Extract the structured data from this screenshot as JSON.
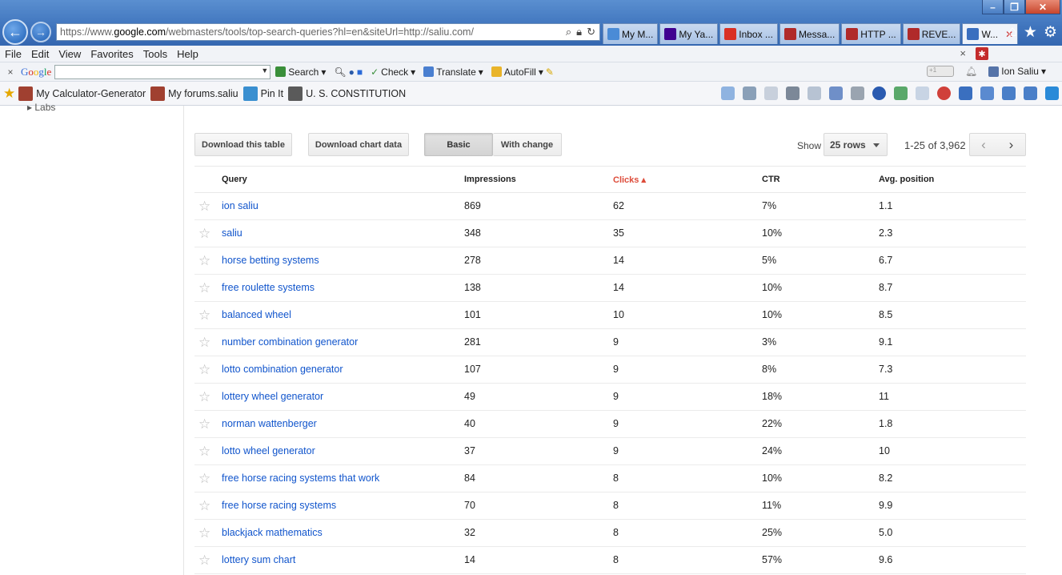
{
  "browser": {
    "url_prefix": "https://www.",
    "url_domain": "google.com",
    "url_rest": "/webmasters/tools/top-search-queries?hl=en&siteUrl=http://saliu.com/",
    "tabs": [
      {
        "label": "My M...",
        "color": "#4a8bd6"
      },
      {
        "label": "My Ya...",
        "color": "#400090"
      },
      {
        "label": "Inbox ...",
        "color": "#d93025"
      },
      {
        "label": "Messa...",
        "color": "#b02a2a"
      },
      {
        "label": "HTTP ...",
        "color": "#b02a2a"
      },
      {
        "label": "REVE...",
        "color": "#b02a2a"
      },
      {
        "label": "W...",
        "color": "#3a6fbf",
        "active": true
      }
    ],
    "menu": [
      "File",
      "Edit",
      "View",
      "Favorites",
      "Tools",
      "Help"
    ],
    "google_bar": {
      "logo": "Google",
      "items": [
        "Search",
        "Check",
        "Translate",
        "AutoFill"
      ],
      "user": "Ion Saliu"
    },
    "favorites": [
      "My Calculator-Generator",
      "My forums.saliu",
      "Pin It",
      "U. S. CONSTITUTION"
    ]
  },
  "sidebar": {
    "labs_label": "Labs"
  },
  "toolbar": {
    "download_table": "Download this table",
    "download_chart": "Download chart data",
    "view_basic": "Basic",
    "view_change": "With change",
    "show_label": "Show",
    "rows_value": "25 rows",
    "range_text": "1-25 of 3,962"
  },
  "table": {
    "headers": {
      "query": "Query",
      "impressions": "Impressions",
      "clicks": "Clicks ▴",
      "ctr": "CTR",
      "position": "Avg. position"
    },
    "rows": [
      {
        "query": "ion saliu",
        "impressions": "869",
        "clicks": "62",
        "ctr": "7%",
        "position": "1.1"
      },
      {
        "query": "saliu",
        "impressions": "348",
        "clicks": "35",
        "ctr": "10%",
        "position": "2.3"
      },
      {
        "query": "horse betting systems",
        "impressions": "278",
        "clicks": "14",
        "ctr": "5%",
        "position": "6.7"
      },
      {
        "query": "free roulette systems",
        "impressions": "138",
        "clicks": "14",
        "ctr": "10%",
        "position": "8.7"
      },
      {
        "query": "balanced wheel",
        "impressions": "101",
        "clicks": "10",
        "ctr": "10%",
        "position": "8.5"
      },
      {
        "query": "number combination generator",
        "impressions": "281",
        "clicks": "9",
        "ctr": "3%",
        "position": "9.1"
      },
      {
        "query": "lotto combination generator",
        "impressions": "107",
        "clicks": "9",
        "ctr": "8%",
        "position": "7.3"
      },
      {
        "query": "lottery wheel generator",
        "impressions": "49",
        "clicks": "9",
        "ctr": "18%",
        "position": "11"
      },
      {
        "query": "norman wattenberger",
        "impressions": "40",
        "clicks": "9",
        "ctr": "22%",
        "position": "1.8"
      },
      {
        "query": "lotto wheel generator",
        "impressions": "37",
        "clicks": "9",
        "ctr": "24%",
        "position": "10"
      },
      {
        "query": "free horse racing systems that work",
        "impressions": "84",
        "clicks": "8",
        "ctr": "10%",
        "position": "8.2"
      },
      {
        "query": "free horse racing systems",
        "impressions": "70",
        "clicks": "8",
        "ctr": "11%",
        "position": "9.9"
      },
      {
        "query": "blackjack mathematics",
        "impressions": "32",
        "clicks": "8",
        "ctr": "25%",
        "position": "5.0"
      },
      {
        "query": "lottery sum chart",
        "impressions": "14",
        "clicks": "8",
        "ctr": "57%",
        "position": "9.6"
      }
    ]
  },
  "colors": {
    "link": "#1155cc",
    "sorted_header": "#dd4b39"
  }
}
